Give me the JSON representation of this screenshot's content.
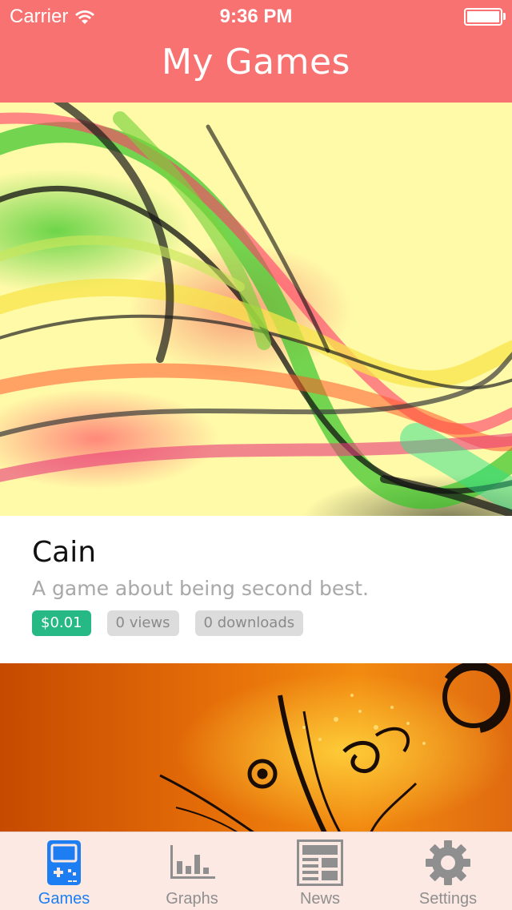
{
  "status_bar": {
    "carrier": "Carrier",
    "time": "9:36 PM",
    "battery_level_percent": 100
  },
  "header": {
    "title": "My Games",
    "background_color": "#f87272"
  },
  "games": [
    {
      "title": "Cain",
      "description": "A game about being second best.",
      "price": "$0.01",
      "views": "0 views",
      "downloads": "0 downloads"
    }
  ],
  "tabbar": {
    "active_color": "#1d7ef3",
    "inactive_color": "#8f8f8f",
    "tabs": [
      {
        "label": "Games",
        "icon": "gamepad-icon",
        "active": true
      },
      {
        "label": "Graphs",
        "icon": "bar-chart-icon",
        "active": false
      },
      {
        "label": "News",
        "icon": "newspaper-icon",
        "active": false
      },
      {
        "label": "Settings",
        "icon": "gear-icon",
        "active": false
      }
    ]
  },
  "colors": {
    "price_tag": "#26b985",
    "stat_tag": "#dcdcdc"
  }
}
